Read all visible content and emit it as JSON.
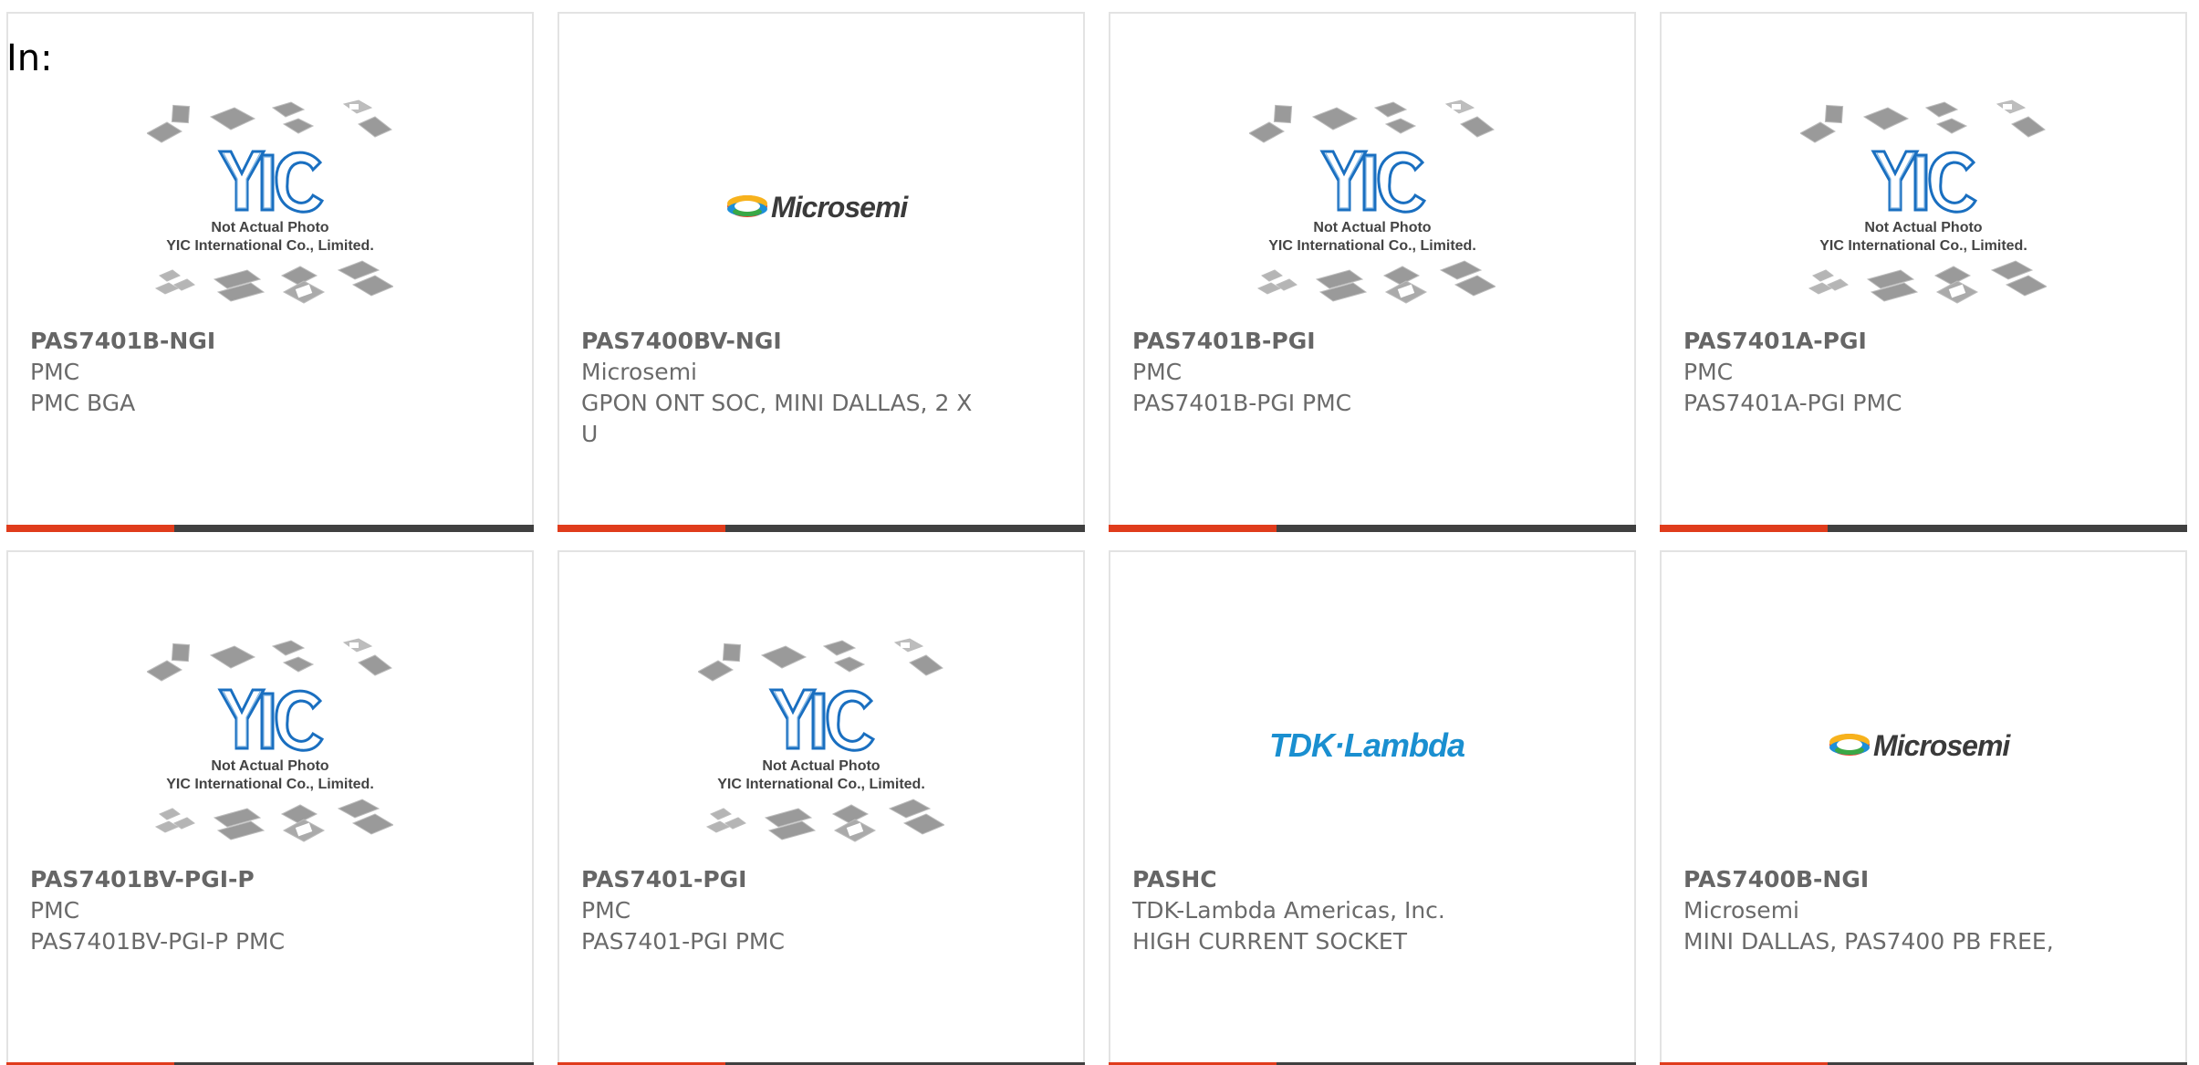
{
  "filter": {
    "label": "In:"
  },
  "products": [
    {
      "part": "PAS7401B-NGI",
      "manufacturer": "PMC",
      "description": "PMC BGA",
      "image": "yic-placeholder"
    },
    {
      "part": "PAS7400BV-NGI",
      "manufacturer": "Microsemi",
      "description": "GPON ONT SOC, MINI DALLAS, 2 X U",
      "image": "microsemi-logo"
    },
    {
      "part": "PAS7401B-PGI",
      "manufacturer": "PMC",
      "description": "PAS7401B-PGI PMC",
      "image": "yic-placeholder"
    },
    {
      "part": "PAS7401A-PGI",
      "manufacturer": "PMC",
      "description": "PAS7401A-PGI PMC",
      "image": "yic-placeholder"
    },
    {
      "part": "PAS7401BV-PGI-P",
      "manufacturer": "PMC",
      "description": "PAS7401BV-PGI-P PMC",
      "image": "yic-placeholder"
    },
    {
      "part": "PAS7401-PGI",
      "manufacturer": "PMC",
      "description": "PAS7401-PGI PMC",
      "image": "yic-placeholder"
    },
    {
      "part": "PASHC",
      "manufacturer": "TDK-Lambda Americas, Inc.",
      "description": "HIGH CURRENT SOCKET",
      "image": "tdk-lambda-logo"
    },
    {
      "part": "PAS7400B-NGI",
      "manufacturer": "Microsemi",
      "description": "MINI DALLAS, PAS7400 PB FREE,",
      "image": "microsemi-logo"
    }
  ],
  "placeholder": {
    "brand": "YIC",
    "line1": "Not Actual Photo",
    "line2": "YIC International Co., Limited."
  },
  "logos": {
    "microsemi": "Microsemi",
    "tdk": "TDK·Lambda"
  },
  "colors": {
    "accent": "#e03c1c",
    "bar": "#404040",
    "yic_blue": "#1a6fc0",
    "tdk_blue": "#1a8fd0"
  }
}
